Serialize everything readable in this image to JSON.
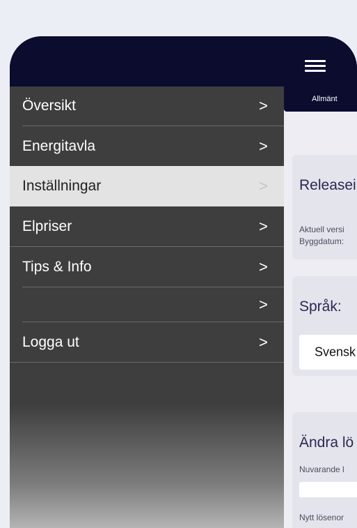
{
  "sidebar": {
    "items": [
      {
        "label": "Översikt",
        "chevron": ">"
      },
      {
        "label": "Energitavla",
        "chevron": ">"
      },
      {
        "label": "Inställningar",
        "chevron": ">",
        "active": true
      },
      {
        "label": "Elpriser",
        "chevron": ">"
      },
      {
        "label": "Tips & Info",
        "chevron": ">"
      },
      {
        "label": "",
        "chevron": ">"
      },
      {
        "label": "Logga ut",
        "chevron": ">"
      }
    ]
  },
  "header": {
    "menu_icon": "hamburger-icon"
  },
  "main": {
    "tab_label": "Allmänt",
    "release_card": {
      "title": "Releasei",
      "current_version_label": "Aktuell versi",
      "build_date_label": "Byggdatum:"
    },
    "language_card": {
      "title": "Språk:",
      "selected_value": "Svensk"
    },
    "password_card": {
      "title": "Ändra lö",
      "current_password_label": "Nuvarande l",
      "new_password_label": "Nytt lösenor"
    }
  },
  "colors": {
    "header_bg": "#0b0c2e",
    "sidebar_bg": "#3e3e3e",
    "active_item_bg": "#e3e3e3",
    "content_bg": "#ededf3",
    "card_bg": "#e4e4ec",
    "title_color": "#2a2852"
  }
}
